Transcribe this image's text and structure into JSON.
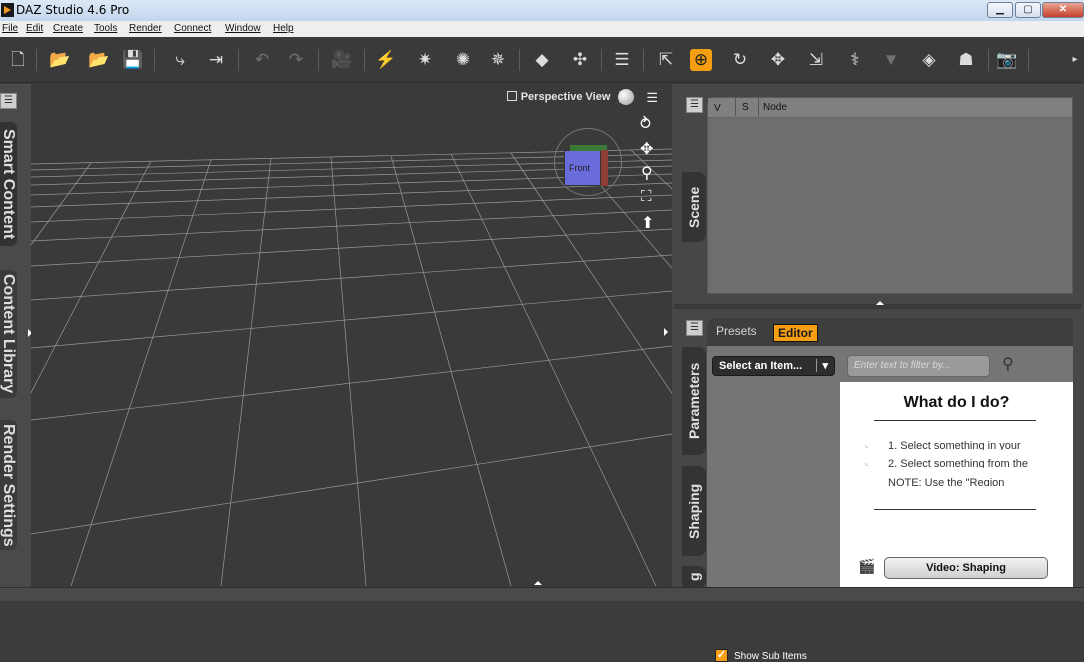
{
  "window": {
    "title": "DAZ Studio 4.6 Pro",
    "controls": {
      "minimize": "▁",
      "maximize": "▢",
      "close": "✕"
    }
  },
  "menu": [
    "File",
    "Edit",
    "Create",
    "Tools",
    "Render",
    "Connect",
    "Window",
    "Help"
  ],
  "toolbar": {
    "icons": [
      "new-file-icon",
      "open-icon",
      "merge-icon",
      "save-icon",
      "import-icon",
      "export-icon",
      "undo-icon",
      "redo-icon",
      "new-camera-icon",
      "new-spotlight-icon",
      "new-pointlight-icon",
      "new-distantlight-icon",
      "new-light-icon",
      "new-primitive-icon",
      "new-null-icon",
      "aux-viewport-icon",
      "node-selection-icon",
      "universal-tool-icon",
      "rotate-tool-icon",
      "translate-tool-icon",
      "scale-tool-icon",
      "joint-editor-icon",
      "surface-selection-icon",
      "geometry-editor-icon",
      "region-navigator-icon",
      "spot-render-icon",
      "more-icon"
    ],
    "active": "universal-tool-icon"
  },
  "left_tabs": [
    {
      "label": "Smart Content",
      "active": true
    },
    {
      "label": "Content Library",
      "active": false
    },
    {
      "label": "Render Settings",
      "active": false
    }
  ],
  "viewport": {
    "view_label": "Perspective View",
    "cube_face": "Front",
    "nav_icons": [
      "orbit-icon",
      "pan-icon",
      "zoom-icon",
      "frame-icon",
      "bank-icon"
    ]
  },
  "scene_pane": {
    "tab": "Scene",
    "columns": [
      "V",
      "S",
      "Node"
    ]
  },
  "parameters_pane": {
    "side_tabs": [
      "Parameters",
      "Shaping",
      "g"
    ],
    "tabs": [
      {
        "label": "Presets",
        "active": false
      },
      {
        "label": "Editor",
        "active": true
      }
    ],
    "select_item": "Select an Item...",
    "filter_placeholder": "Enter text to filter by...",
    "help_title": "What do I do?",
    "help_lines": [
      "1. Select something in your",
      "2. Select something from the",
      "NOTE: Use the \"Region"
    ],
    "help_note_bold": "NOTE:",
    "video_button": "Video: Shaping",
    "show_sub_items": "Show Sub Items",
    "show_sub_items_checked": true
  }
}
